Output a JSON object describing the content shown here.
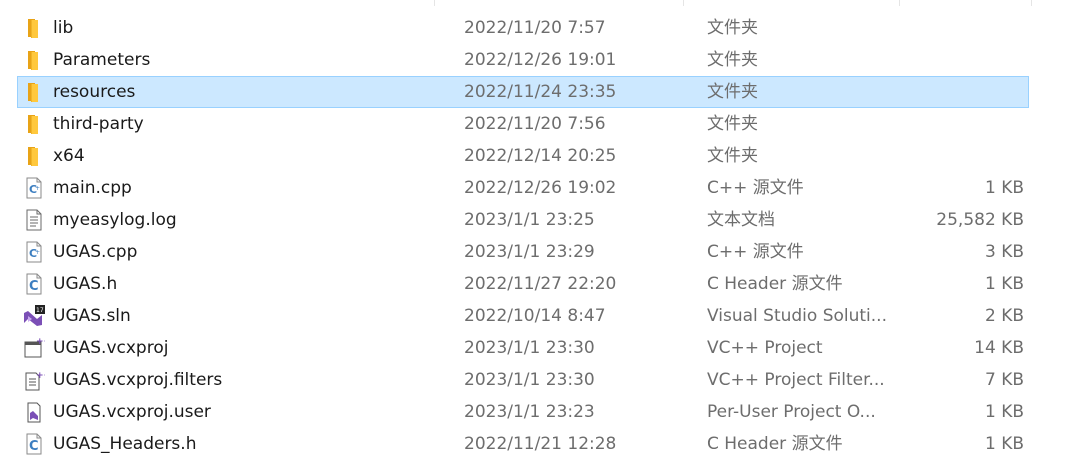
{
  "files": [
    {
      "name": "lib",
      "date": "2022/11/20 7:57",
      "type": "文件夹",
      "size": "",
      "icon": "folder-icon"
    },
    {
      "name": "Parameters",
      "date": "2022/12/26 19:01",
      "type": "文件夹",
      "size": "",
      "icon": "folder-icon"
    },
    {
      "name": "resources",
      "date": "2022/11/24 23:35",
      "type": "文件夹",
      "size": "",
      "icon": "folder-icon",
      "selected": true
    },
    {
      "name": "third-party",
      "date": "2022/11/20 7:56",
      "type": "文件夹",
      "size": "",
      "icon": "folder-icon"
    },
    {
      "name": "x64",
      "date": "2022/12/14 20:25",
      "type": "文件夹",
      "size": "",
      "icon": "folder-icon"
    },
    {
      "name": "main.cpp",
      "date": "2022/12/26 19:02",
      "type": "C++ 源文件",
      "size": "1 KB",
      "icon": "cpp-file-icon"
    },
    {
      "name": "myeasylog.log",
      "date": "2023/1/1 23:25",
      "type": "文本文档",
      "size": "25,582 KB",
      "icon": "text-file-icon"
    },
    {
      "name": "UGAS.cpp",
      "date": "2023/1/1 23:29",
      "type": "C++ 源文件",
      "size": "3 KB",
      "icon": "cpp-file-icon"
    },
    {
      "name": "UGAS.h",
      "date": "2022/11/27 22:20",
      "type": "C Header 源文件",
      "size": "1 KB",
      "icon": "header-file-icon"
    },
    {
      "name": "UGAS.sln",
      "date": "2022/10/14 8:47",
      "type": "Visual Studio Soluti...",
      "size": "2 KB",
      "icon": "vs-solution-icon"
    },
    {
      "name": "UGAS.vcxproj",
      "date": "2023/1/1 23:30",
      "type": "VC++ Project",
      "size": "14 KB",
      "icon": "vcxproj-icon"
    },
    {
      "name": "UGAS.vcxproj.filters",
      "date": "2023/1/1 23:30",
      "type": "VC++ Project Filter...",
      "size": "7 KB",
      "icon": "filters-file-icon"
    },
    {
      "name": "UGAS.vcxproj.user",
      "date": "2023/1/1 23:23",
      "type": "Per-User Project O...",
      "size": "1 KB",
      "icon": "user-file-icon"
    },
    {
      "name": "UGAS_Headers.h",
      "date": "2022/11/21 12:28",
      "type": "C Header 源文件",
      "size": "1 KB",
      "icon": "header-file-icon"
    }
  ],
  "colors": {
    "selection_bg": "#cce8ff",
    "selection_border": "#99d1ff",
    "folder": "#ffc83d",
    "muted_text": "#6d6d6d"
  }
}
